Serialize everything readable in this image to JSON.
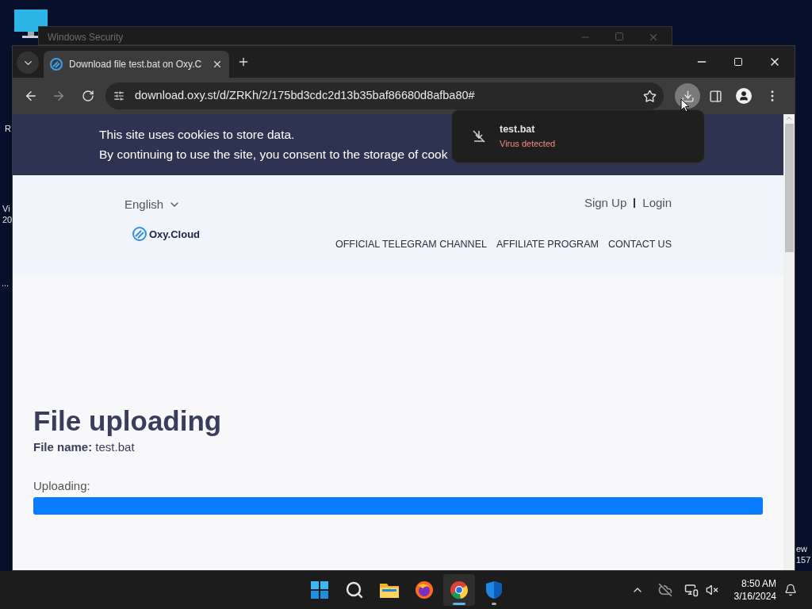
{
  "desktop": {
    "fragments": [
      {
        "lines": [
          "R"
        ]
      },
      {
        "lines": [
          "Vi",
          "20"
        ]
      },
      {
        "lines": [
          "..."
        ]
      },
      {
        "lines": [
          "ew",
          "157"
        ]
      }
    ]
  },
  "background_window": {
    "title": "Windows Security"
  },
  "browser": {
    "tabs": [
      {
        "title": "Download file test.bat on Oxy.C",
        "selected": true
      }
    ],
    "address": "download.oxy.st/d/ZRKh/2/175bd3cdc2d13b35baf86680d8afba80#",
    "downloads_button": {
      "highlighted": true
    },
    "download_bubble": {
      "file_name": "test.bat",
      "status": "Virus detected"
    }
  },
  "page": {
    "cookie_notice": [
      "This site uses cookies to store data.",
      "By continuing to use the site, you consent to the storage of cook"
    ],
    "language": "English",
    "auth_links": [
      "Sign Up",
      "Login"
    ],
    "logo_text": "Oxy.Cloud",
    "nav": [
      "OFFICIAL TELEGRAM CHANNEL",
      "AFFILIATE PROGRAM",
      "CONTACT US"
    ],
    "heading": "File uploading",
    "file_line": "**File name:** test.bat",
    "upload_label": "Uploading:",
    "progress": {
      "level": 1
    }
  },
  "taskbar": {
    "items": [
      {
        "selected": false,
        "running": false
      },
      {
        "selected": false,
        "running": false
      },
      {
        "selected": false,
        "running": false
      },
      {
        "selected": false,
        "running": false
      },
      {
        "selected": true,
        "running": true
      },
      {
        "selected": false,
        "running": true
      }
    ],
    "time": "8:50 AM",
    "date": "3/16/2024"
  }
}
